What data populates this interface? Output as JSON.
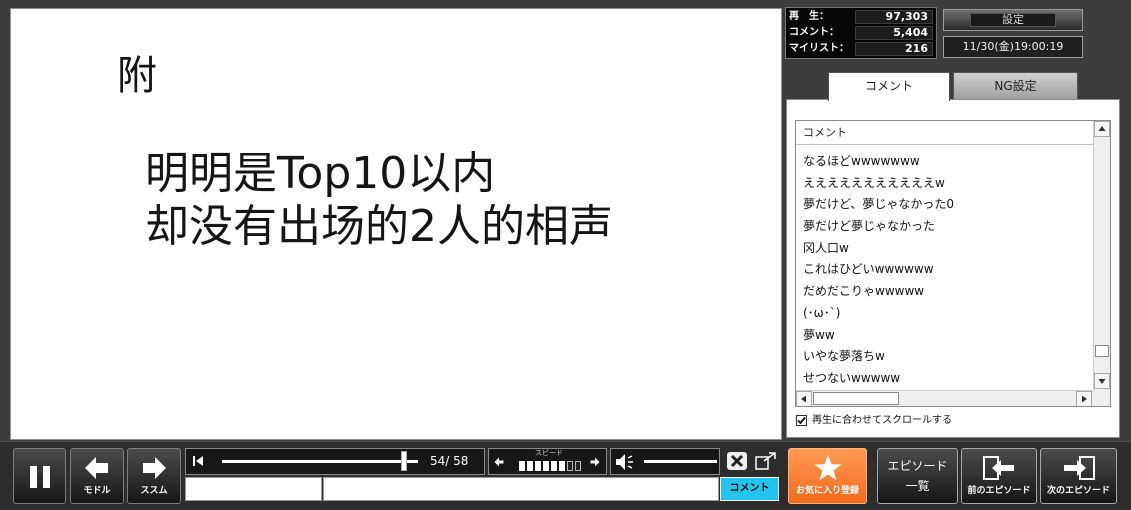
{
  "video": {
    "lines": [
      "附",
      "明明是Top10以内",
      "却没有出场的2人的相声"
    ]
  },
  "stats": {
    "views_label": "再　生：",
    "views": "97,303",
    "comments_label": "コメント：",
    "comments": "5,404",
    "mylist_label": "マイリスト：",
    "mylist": "216"
  },
  "settings_label": "設定",
  "datetime": "11/30(金)19:00:19",
  "tabs": [
    {
      "label": "コメント",
      "active": true
    },
    {
      "label": "NG設定",
      "active": false
    }
  ],
  "comment_list": {
    "header": "コメント",
    "items": [
      "なるほどwwwwwww",
      "えええええええええええw",
      "夢だけど、夢じゃなかった0",
      "夢だけど夢じゃなかった",
      "冈人口w",
      "これはひどいwwwwww",
      "だめだこりゃwwwww",
      "(･ω･`)",
      "夢ww",
      "いやな夢落ちw",
      "せつないwwwww"
    ]
  },
  "autoscroll": {
    "label": "再生に合わせてスクロールする",
    "checked": true
  },
  "controls": {
    "back_label": "モドル",
    "forward_label": "ススム",
    "position_text": "54/ 58",
    "seek_progress": 0.93,
    "speed_label": "スピード",
    "speed_level": 6,
    "speed_max": 8,
    "volume_level": 1.0
  },
  "comment_input": {
    "command_value": "",
    "comment_value": "",
    "button_label": "コメント"
  },
  "buttons": {
    "favorite": "お気に入り登録",
    "episode_list_line1": "エピソード",
    "episode_list_line2": "一覧",
    "prev_episode": "前のエピソード",
    "next_episode": "次のエピソード"
  },
  "colors": {
    "comment_button": "#22c4ee",
    "favorite_button": "#f26a1b",
    "video_background": "#ffffff"
  },
  "icons": [
    "pause-icon",
    "arrow-left-icon",
    "arrow-right-icon",
    "skip-start-icon",
    "speaker-icon",
    "close-icon",
    "expand-icon",
    "star-icon",
    "prev-episode-icon",
    "next-episode-icon",
    "check-icon"
  ]
}
